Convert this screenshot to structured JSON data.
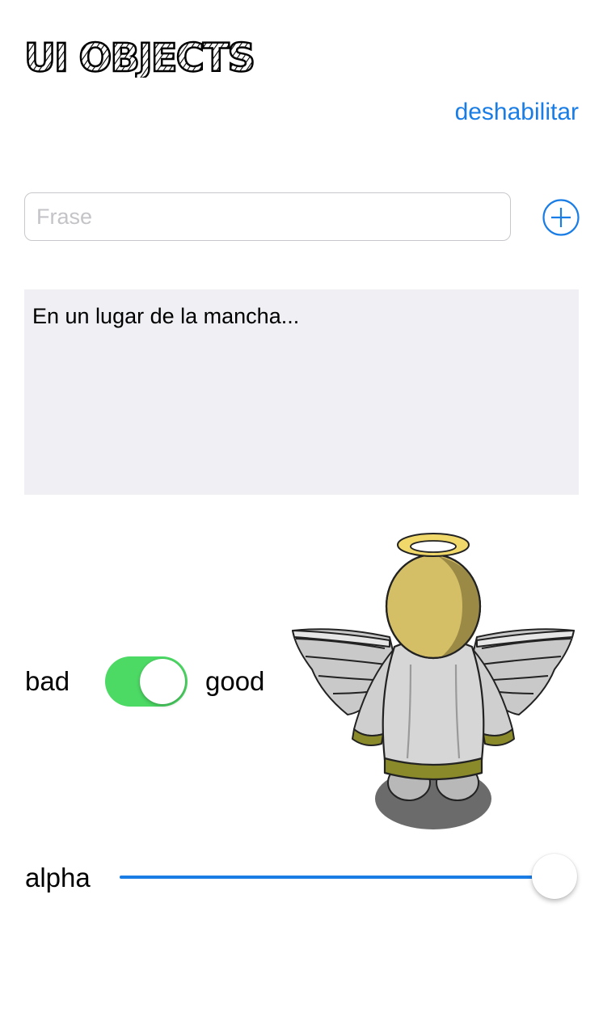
{
  "header": {
    "logo_text": "UI OBJECTS"
  },
  "toolbar": {
    "disable_label": "deshabilitar"
  },
  "phrase": {
    "placeholder": "Frase",
    "value": ""
  },
  "add_icon": "plus-circle-icon",
  "text_area": {
    "content": "En un lugar de la mancha..."
  },
  "switch": {
    "left_label": "bad",
    "right_label": "good",
    "on": true,
    "on_color": "#4cd964"
  },
  "image": {
    "subject": "angel"
  },
  "slider": {
    "label": "alpha",
    "value": 1.0,
    "min": 0,
    "max": 1
  },
  "colors": {
    "accent": "#1a7de6",
    "text_area_bg": "#efeff4"
  }
}
